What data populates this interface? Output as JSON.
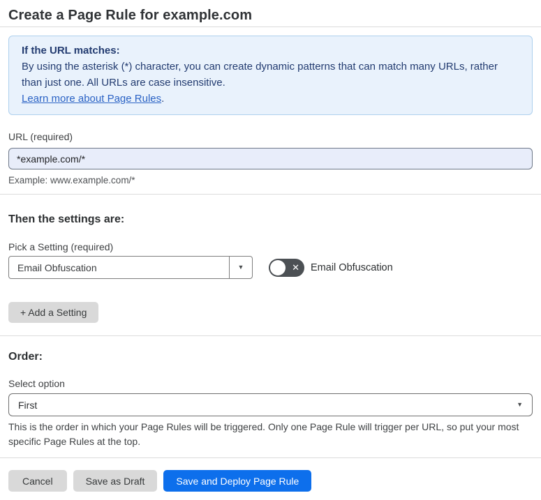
{
  "page": {
    "title": "Create a Page Rule for example.com"
  },
  "info_box": {
    "heading": "If the URL matches:",
    "body": "By using the asterisk (*) character, you can create dynamic patterns that can match many URLs, rather than just one. All URLs are case insensitive.",
    "link_label": "Learn more about Page Rules",
    "link_suffix": "."
  },
  "url_field": {
    "label": "URL (required)",
    "value": "*example.com/*",
    "example": "Example: www.example.com/*"
  },
  "settings_section": {
    "heading": "Then the settings are:",
    "picker_label": "Pick a Setting (required)",
    "picker_value": "Email Obfuscation",
    "toggle_state": "off",
    "toggle_label": "Email Obfuscation",
    "add_setting_button": "+ Add a Setting"
  },
  "order_section": {
    "heading": "Order:",
    "select_label": "Select option",
    "select_value": "First",
    "help_text": "This is the order in which your Page Rules will be triggered. Only one Page Rule will trigger per URL, so put your most specific Page Rules at the top."
  },
  "footer": {
    "cancel_label": "Cancel",
    "save_draft_label": "Save as Draft",
    "save_deploy_label": "Save and Deploy Page Rule"
  },
  "icons": {
    "toggle_off_glyph": "✕",
    "caret_down_glyph": "▼"
  },
  "colors": {
    "accent_blue": "#0d6fec",
    "link_blue": "#2b63c5",
    "info_background": "#e9f2fc",
    "info_border": "#aed0ee",
    "info_text": "#223b70",
    "input_background": "#e8edfa",
    "toggle_off_background": "#4c5054",
    "gray_button": "#d9d9d9",
    "divider": "#dcdcdc"
  }
}
